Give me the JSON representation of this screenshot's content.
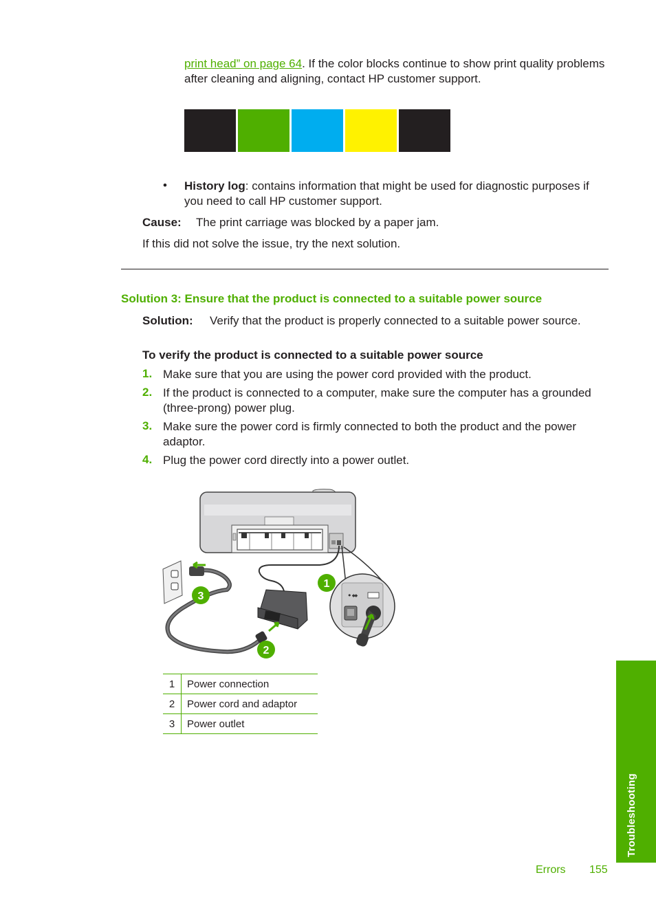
{
  "intro": {
    "link_text": "print head” on page 64",
    "text": ". If the color blocks continue to show print quality problems after cleaning and aligning, contact HP customer support."
  },
  "color_blocks": [
    {
      "name": "black",
      "color": "#231f20"
    },
    {
      "name": "green",
      "color": "#4faf00"
    },
    {
      "name": "cyan",
      "color": "#00adef"
    },
    {
      "name": "yellow",
      "color": "#fff200"
    },
    {
      "name": "black",
      "color": "#231f20"
    }
  ],
  "bullet": {
    "symbol": "•",
    "term": "History log",
    "text": ": contains information that might be used for diagnostic purposes if you need to call HP customer support."
  },
  "cause": {
    "label": "Cause:",
    "text": "The print carriage was blocked by a paper jam."
  },
  "next_solution": "If this did not solve the issue, try the next solution.",
  "solution3": {
    "heading": "Solution 3: Ensure that the product is connected to a suitable power source",
    "label": "Solution:",
    "text": "Verify that the product is properly connected to a suitable power source.",
    "procedure_heading": "To verify the product is connected to a suitable power source",
    "steps": [
      {
        "num": "1.",
        "text": "Make sure that you are using the power cord provided with the product."
      },
      {
        "num": "2.",
        "text": "If the product is connected to a computer, make sure the computer has a grounded (three-prong) power plug."
      },
      {
        "num": "3.",
        "text": "Make sure the power cord is firmly connected to both the product and the power adaptor."
      },
      {
        "num": "4.",
        "text": "Plug the power cord directly into a power outlet."
      }
    ]
  },
  "diagram": {
    "callouts": [
      "1",
      "2",
      "3"
    ]
  },
  "legend": [
    {
      "num": "1",
      "label": "Power connection"
    },
    {
      "num": "2",
      "label": "Power cord and adaptor"
    },
    {
      "num": "3",
      "label": "Power outlet"
    }
  ],
  "side_tab": "Troubleshooting",
  "footer": {
    "section": "Errors",
    "page": "155"
  },
  "colors": {
    "accent": "#4faf00",
    "text": "#231f20"
  }
}
